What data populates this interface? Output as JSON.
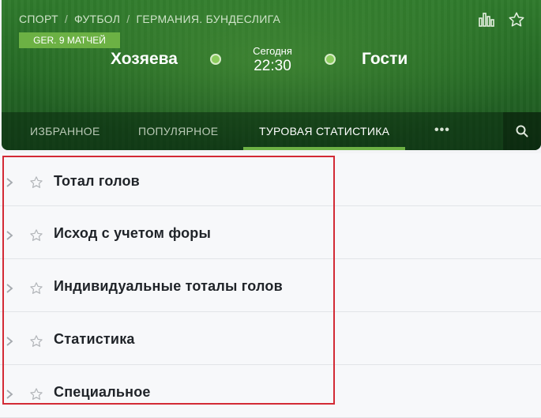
{
  "breadcrumb": [
    "СПОРТ",
    "ФУТБОЛ",
    "ГЕРМАНИЯ. БУНДЕСЛИГА"
  ],
  "breadcrumb_separator": "/",
  "league_badge": "GER. 9 МАТЧЕЙ",
  "icons": {
    "stats": "bar-chart-icon",
    "favorite": "star-outline-icon",
    "search": "search-icon",
    "expand": "chevron-right-icon"
  },
  "match": {
    "home": "Хозяева",
    "away": "Гости",
    "day": "Сегодня",
    "time": "22:30"
  },
  "nav": {
    "tabs": [
      {
        "label": "ИЗБРАННОЕ",
        "active": false
      },
      {
        "label": "ПОПУЛЯРНОЕ",
        "active": false
      },
      {
        "label": "ТУРОВАЯ СТАТИСТИКА",
        "active": true
      }
    ],
    "more": "•••"
  },
  "markets": [
    {
      "label": "Тотал голов"
    },
    {
      "label": "Исход с учетом форы"
    },
    {
      "label": "Индивидуальные тоталы голов"
    },
    {
      "label": "Статистика"
    },
    {
      "label": "Специальное"
    }
  ],
  "colors": {
    "accent": "#6cb144",
    "highlight": "#d32a35",
    "header_green": "#256a25"
  }
}
